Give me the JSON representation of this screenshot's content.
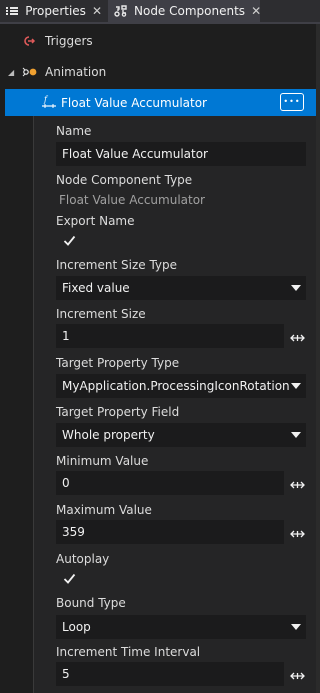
{
  "tabs": [
    {
      "label": "Properties",
      "close": "✕",
      "icon": "list-icon",
      "active": false
    },
    {
      "label": "Node Components",
      "close": "✕",
      "icon": "node-components-icon",
      "active": true
    }
  ],
  "tree": {
    "triggers_label": "Triggers",
    "animation_label": "Animation",
    "selected_label": "Float Value Accumulator",
    "more_label": "•••"
  },
  "properties": {
    "name_label": "Name",
    "name_value": "Float Value Accumulator",
    "type_label": "Node Component Type",
    "type_value": "Float Value Accumulator",
    "export_label": "Export Name",
    "export_checked": true,
    "increment_size_type_label": "Increment Size Type",
    "increment_size_type_value": "Fixed value",
    "increment_size_label": "Increment Size",
    "increment_size_value": "1",
    "target_property_type_label": "Target Property Type",
    "target_property_type_value": "MyApplication.ProcessingIconRotation",
    "target_property_field_label": "Target Property Field",
    "target_property_field_value": "Whole property",
    "minimum_label": "Minimum Value",
    "minimum_value": "0",
    "maximum_label": "Maximum Value",
    "maximum_value": "359",
    "autoplay_label": "Autoplay",
    "autoplay_checked": true,
    "bound_type_label": "Bound Type",
    "bound_type_value": "Loop",
    "interval_label": "Increment Time Interval",
    "interval_value": "5"
  },
  "colors": {
    "selection": "#0078d4",
    "background": "#1e1e1e",
    "field": "#1b1b1c"
  }
}
